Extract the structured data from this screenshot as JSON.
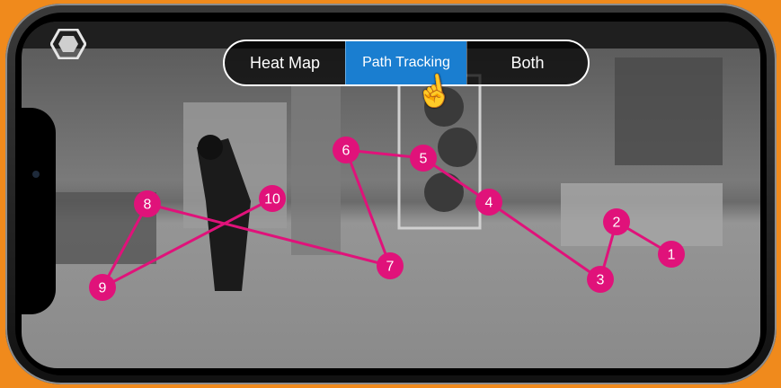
{
  "toggle": {
    "tabs": [
      {
        "label": "Heat Map",
        "active": false
      },
      {
        "label": "Path Tracking",
        "active": true
      },
      {
        "label": "Both",
        "active": false
      }
    ]
  },
  "icons": {
    "logo": "hexagon-logo-icon",
    "pointer": "pointing-hand-cursor-icon"
  },
  "colors": {
    "path": "#e0127a",
    "active_tab": "#1a7ed0",
    "background": "#f08a1c"
  },
  "path_points": [
    {
      "label": "1"
    },
    {
      "label": "2"
    },
    {
      "label": "3"
    },
    {
      "label": "4"
    },
    {
      "label": "5"
    },
    {
      "label": "6"
    },
    {
      "label": "7"
    },
    {
      "label": "8"
    },
    {
      "label": "9"
    },
    {
      "label": "10"
    }
  ]
}
